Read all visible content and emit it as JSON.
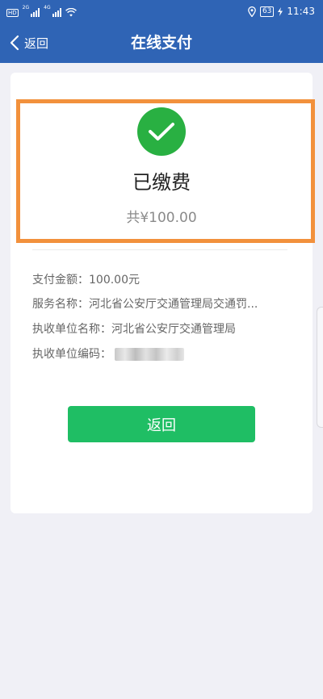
{
  "status_bar": {
    "sim_label": "HD",
    "net_1": "2G",
    "net_2": "4G",
    "battery": "63",
    "time": "11:43"
  },
  "nav": {
    "back_label": "返回",
    "title": "在线支付"
  },
  "result": {
    "status": "已缴费",
    "total": "共¥100.00"
  },
  "details": {
    "amount_label": "支付金额：",
    "amount_value": "100.00元",
    "service_label": "服务名称：",
    "service_value": "河北省公安厅交通管理局交通罚...",
    "unit_name_label": "执收单位名称：",
    "unit_name_value": "河北省公安厅交通管理局",
    "unit_code_label": "执收单位编码："
  },
  "actions": {
    "return_label": "返回"
  },
  "colors": {
    "nav_bg": "#2f64b5",
    "success": "#29b042",
    "button": "#1fbe64",
    "highlight": "#f2913c"
  }
}
